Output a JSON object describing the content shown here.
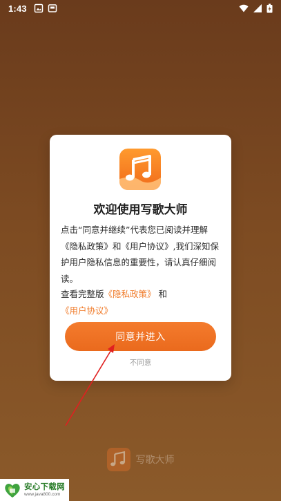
{
  "status_bar": {
    "time": "1:43",
    "left_icons": [
      "gallery-icon",
      "screen-icon"
    ],
    "right_icons": [
      "wifi-icon",
      "signal-icon",
      "battery-icon"
    ]
  },
  "dialog": {
    "title": "欢迎使用写歌大师",
    "body": "点击“同意并继续”代表您已阅读并理解《隐私政策》和《用户协议》,我们深知保护用户隐私信息的重要性，请认真仔细阅读。",
    "links_prefix": "查看完整版",
    "privacy_link": "《隐私政策》",
    "links_and": "和",
    "agreement_link": "《用户协议》",
    "agree_button": "同意并进入",
    "disagree_button": "不同意"
  },
  "brand": {
    "name": "写歌大师"
  },
  "watermark": {
    "title": "安心下载网",
    "url": "www.java800.com"
  },
  "colors": {
    "accent": "#f07a28",
    "button": "#ee7224",
    "background": "#7d4b22",
    "annotation": "#e02020"
  }
}
